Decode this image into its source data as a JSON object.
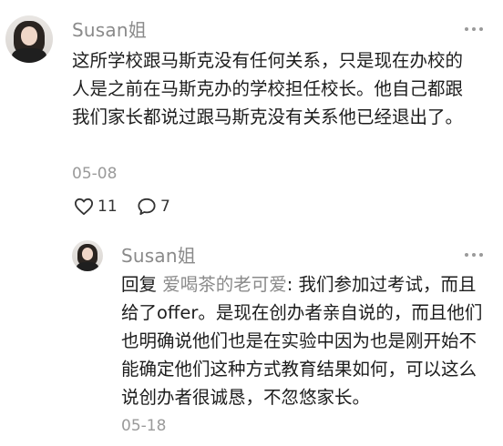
{
  "comment": {
    "author": "Susan姐",
    "text": "这所学校跟马斯克没有任何关系，只是现在办校的人是之前在马斯克办的学校担任校长。他自己都跟我们家长都说过跟马斯克没有关系他已经退出了。",
    "date": "05-08",
    "likes": "11",
    "replies": "7"
  },
  "reply": {
    "author": "Susan姐",
    "prefix": "回复",
    "reply_to": "爱喝茶的老可爱",
    "text": ": 我们参加过考试，而且给了offer。是现在创办者亲自说的，而且他们也明确说他们也是在实验中因为也是刚开始不能确定他们这种方式教育结果如何，可以这么说创办者很诚恳，不忽悠家长。",
    "date": "05-18"
  },
  "icons": {
    "like": "heart-outline-icon",
    "comment": "speech-bubble-icon",
    "more": "more-dots-icon"
  },
  "colors": {
    "meta_gray": "#9a9a9a",
    "reply_user": "#8a8a8a",
    "text": "#1d1d1d"
  }
}
